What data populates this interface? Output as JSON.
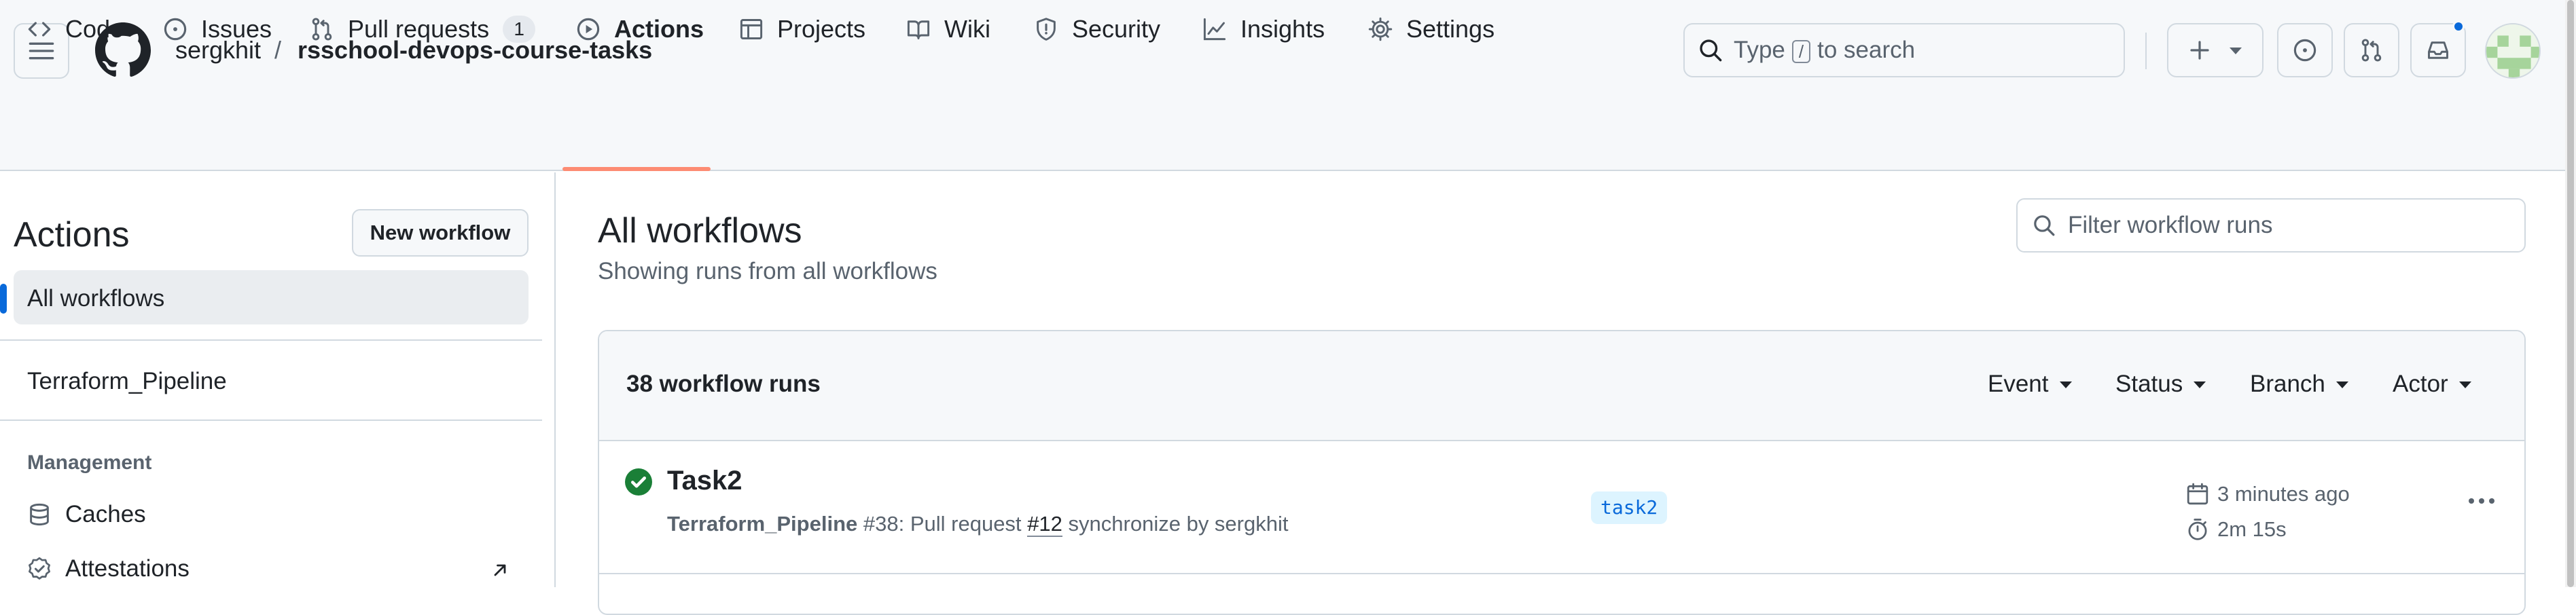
{
  "header": {
    "owner": "sergkhit",
    "separator": "/",
    "repo": "rsschool-devops-course-tasks",
    "search": {
      "prefix": "Type",
      "key": "/",
      "suffix": "to search"
    },
    "icons": [
      "menu-icon",
      "github-logo",
      "search-icon",
      "plus-icon",
      "issue-opened-icon",
      "git-pull-request-icon",
      "inbox-icon"
    ],
    "notification_color": "#0969da"
  },
  "tabs": [
    {
      "label": "Code",
      "icon": "code-icon"
    },
    {
      "label": "Issues",
      "icon": "issue-opened-icon"
    },
    {
      "label": "Pull requests",
      "icon": "git-pull-request-icon",
      "count": "1"
    },
    {
      "label": "Actions",
      "icon": "play-icon",
      "active": true
    },
    {
      "label": "Projects",
      "icon": "table-icon"
    },
    {
      "label": "Wiki",
      "icon": "book-icon"
    },
    {
      "label": "Security",
      "icon": "shield-icon"
    },
    {
      "label": "Insights",
      "icon": "graph-icon"
    },
    {
      "label": "Settings",
      "icon": "gear-icon"
    }
  ],
  "sidebar": {
    "title": "Actions",
    "new_workflow": "New workflow",
    "all_workflows": "All workflows",
    "workflows": [
      "Terraform_Pipeline"
    ],
    "management_heading": "Management",
    "management_items": [
      {
        "label": "Caches",
        "icon": "database-icon"
      },
      {
        "label": "Attestations",
        "icon": "verified-icon"
      }
    ]
  },
  "main": {
    "title": "All workflows",
    "subtitle": "Showing runs from all workflows",
    "filter_placeholder": "Filter workflow runs",
    "runs_count": "38 workflow runs",
    "filters": [
      "Event",
      "Status",
      "Branch",
      "Actor"
    ],
    "runs": [
      {
        "title": "Task2",
        "status": "success",
        "workflow": "Terraform_Pipeline",
        "run_number": "#38",
        "event_text": "Pull request",
        "pr": "#12",
        "action": "synchronize by sergkhit",
        "branch": "task2",
        "time_ago": "3 minutes ago",
        "duration": "2m 15s"
      }
    ]
  },
  "colors": {
    "accent": "#0969da",
    "success": "#1a7f37",
    "active_tab_underline": "#fd8c73",
    "header_bg": "#f6f8fa"
  }
}
